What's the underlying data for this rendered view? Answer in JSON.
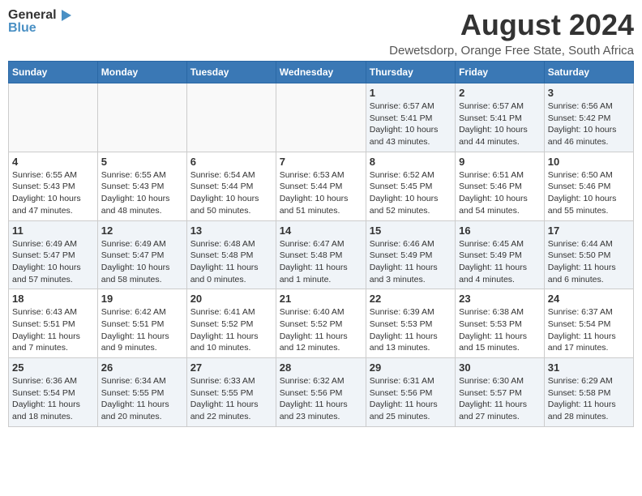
{
  "header": {
    "logo_line1": "General",
    "logo_line2": "Blue",
    "title": "August 2024",
    "subtitle": "Dewetsdorp, Orange Free State, South Africa"
  },
  "calendar": {
    "days_of_week": [
      "Sunday",
      "Monday",
      "Tuesday",
      "Wednesday",
      "Thursday",
      "Friday",
      "Saturday"
    ],
    "weeks": [
      [
        {
          "day": "",
          "info": ""
        },
        {
          "day": "",
          "info": ""
        },
        {
          "day": "",
          "info": ""
        },
        {
          "day": "",
          "info": ""
        },
        {
          "day": "1",
          "info": "Sunrise: 6:57 AM\nSunset: 5:41 PM\nDaylight: 10 hours\nand 43 minutes."
        },
        {
          "day": "2",
          "info": "Sunrise: 6:57 AM\nSunset: 5:41 PM\nDaylight: 10 hours\nand 44 minutes."
        },
        {
          "day": "3",
          "info": "Sunrise: 6:56 AM\nSunset: 5:42 PM\nDaylight: 10 hours\nand 46 minutes."
        }
      ],
      [
        {
          "day": "4",
          "info": "Sunrise: 6:55 AM\nSunset: 5:43 PM\nDaylight: 10 hours\nand 47 minutes."
        },
        {
          "day": "5",
          "info": "Sunrise: 6:55 AM\nSunset: 5:43 PM\nDaylight: 10 hours\nand 48 minutes."
        },
        {
          "day": "6",
          "info": "Sunrise: 6:54 AM\nSunset: 5:44 PM\nDaylight: 10 hours\nand 50 minutes."
        },
        {
          "day": "7",
          "info": "Sunrise: 6:53 AM\nSunset: 5:44 PM\nDaylight: 10 hours\nand 51 minutes."
        },
        {
          "day": "8",
          "info": "Sunrise: 6:52 AM\nSunset: 5:45 PM\nDaylight: 10 hours\nand 52 minutes."
        },
        {
          "day": "9",
          "info": "Sunrise: 6:51 AM\nSunset: 5:46 PM\nDaylight: 10 hours\nand 54 minutes."
        },
        {
          "day": "10",
          "info": "Sunrise: 6:50 AM\nSunset: 5:46 PM\nDaylight: 10 hours\nand 55 minutes."
        }
      ],
      [
        {
          "day": "11",
          "info": "Sunrise: 6:49 AM\nSunset: 5:47 PM\nDaylight: 10 hours\nand 57 minutes."
        },
        {
          "day": "12",
          "info": "Sunrise: 6:49 AM\nSunset: 5:47 PM\nDaylight: 10 hours\nand 58 minutes."
        },
        {
          "day": "13",
          "info": "Sunrise: 6:48 AM\nSunset: 5:48 PM\nDaylight: 11 hours\nand 0 minutes."
        },
        {
          "day": "14",
          "info": "Sunrise: 6:47 AM\nSunset: 5:48 PM\nDaylight: 11 hours\nand 1 minute."
        },
        {
          "day": "15",
          "info": "Sunrise: 6:46 AM\nSunset: 5:49 PM\nDaylight: 11 hours\nand 3 minutes."
        },
        {
          "day": "16",
          "info": "Sunrise: 6:45 AM\nSunset: 5:49 PM\nDaylight: 11 hours\nand 4 minutes."
        },
        {
          "day": "17",
          "info": "Sunrise: 6:44 AM\nSunset: 5:50 PM\nDaylight: 11 hours\nand 6 minutes."
        }
      ],
      [
        {
          "day": "18",
          "info": "Sunrise: 6:43 AM\nSunset: 5:51 PM\nDaylight: 11 hours\nand 7 minutes."
        },
        {
          "day": "19",
          "info": "Sunrise: 6:42 AM\nSunset: 5:51 PM\nDaylight: 11 hours\nand 9 minutes."
        },
        {
          "day": "20",
          "info": "Sunrise: 6:41 AM\nSunset: 5:52 PM\nDaylight: 11 hours\nand 10 minutes."
        },
        {
          "day": "21",
          "info": "Sunrise: 6:40 AM\nSunset: 5:52 PM\nDaylight: 11 hours\nand 12 minutes."
        },
        {
          "day": "22",
          "info": "Sunrise: 6:39 AM\nSunset: 5:53 PM\nDaylight: 11 hours\nand 13 minutes."
        },
        {
          "day": "23",
          "info": "Sunrise: 6:38 AM\nSunset: 5:53 PM\nDaylight: 11 hours\nand 15 minutes."
        },
        {
          "day": "24",
          "info": "Sunrise: 6:37 AM\nSunset: 5:54 PM\nDaylight: 11 hours\nand 17 minutes."
        }
      ],
      [
        {
          "day": "25",
          "info": "Sunrise: 6:36 AM\nSunset: 5:54 PM\nDaylight: 11 hours\nand 18 minutes."
        },
        {
          "day": "26",
          "info": "Sunrise: 6:34 AM\nSunset: 5:55 PM\nDaylight: 11 hours\nand 20 minutes."
        },
        {
          "day": "27",
          "info": "Sunrise: 6:33 AM\nSunset: 5:55 PM\nDaylight: 11 hours\nand 22 minutes."
        },
        {
          "day": "28",
          "info": "Sunrise: 6:32 AM\nSunset: 5:56 PM\nDaylight: 11 hours\nand 23 minutes."
        },
        {
          "day": "29",
          "info": "Sunrise: 6:31 AM\nSunset: 5:56 PM\nDaylight: 11 hours\nand 25 minutes."
        },
        {
          "day": "30",
          "info": "Sunrise: 6:30 AM\nSunset: 5:57 PM\nDaylight: 11 hours\nand 27 minutes."
        },
        {
          "day": "31",
          "info": "Sunrise: 6:29 AM\nSunset: 5:58 PM\nDaylight: 11 hours\nand 28 minutes."
        }
      ]
    ]
  }
}
